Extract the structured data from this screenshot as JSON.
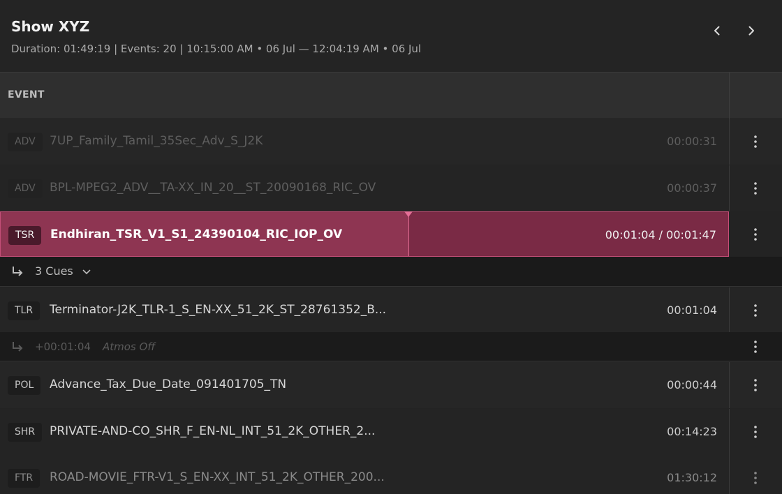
{
  "header": {
    "title": "Show XYZ",
    "subtitle": "Duration: 01:49:19 | Events: 20 | 10:15:00 AM • 06 Jul  —  12:04:19 AM • 06 Jul",
    "prev_icon": "chevron-left-icon",
    "next_icon": "chevron-right-icon"
  },
  "table": {
    "column_header": "EVENT"
  },
  "events": [
    {
      "tag": "ADV",
      "name": "7UP_Family_Tamil_35Sec_Adv_S_J2K",
      "duration": "00:00:31",
      "state": "played"
    },
    {
      "tag": "ADV",
      "name": "BPL-MPEG2_ADV__TA-XX_IN_20__ST_20090168_RIC_OV",
      "duration": "00:00:37",
      "state": "played"
    },
    {
      "tag": "TSR",
      "name": "Endhiran_TSR_V1_S1_24390104_RIC_IOP_OV",
      "duration": "00:01:04 / 00:01:47",
      "state": "playing",
      "progress": 0.56
    },
    {
      "tag": "TLR",
      "name": "Terminator-J2K_TLR-1_S_EN-XX_51_2K_ST_28761352_B...",
      "duration": "00:01:04",
      "state": "upcoming"
    },
    {
      "tag": "POL",
      "name": "Advance_Tax_Due_Date_091401705_TN",
      "duration": "00:00:44",
      "state": "upcoming"
    },
    {
      "tag": "SHR",
      "name": "PRIVATE-AND-CO_SHR_F_EN-NL_INT_51_2K_OTHER_2...",
      "duration": "00:14:23",
      "state": "upcoming"
    },
    {
      "tag": "FTR",
      "name": "ROAD-MOVIE_FTR-V1_S_EN-XX_INT_51_2K_OTHER_200...",
      "duration": "01:30:12",
      "state": "upcoming"
    }
  ],
  "cues_toggle": {
    "label": "3 Cues",
    "icon": "chevron-down-icon"
  },
  "cue": {
    "offset": "+00:01:04",
    "name": "Atmos Off"
  },
  "colors": {
    "active_row": "#7a2a45",
    "active_border": "#c54f78",
    "playhead": "#e56f97"
  }
}
